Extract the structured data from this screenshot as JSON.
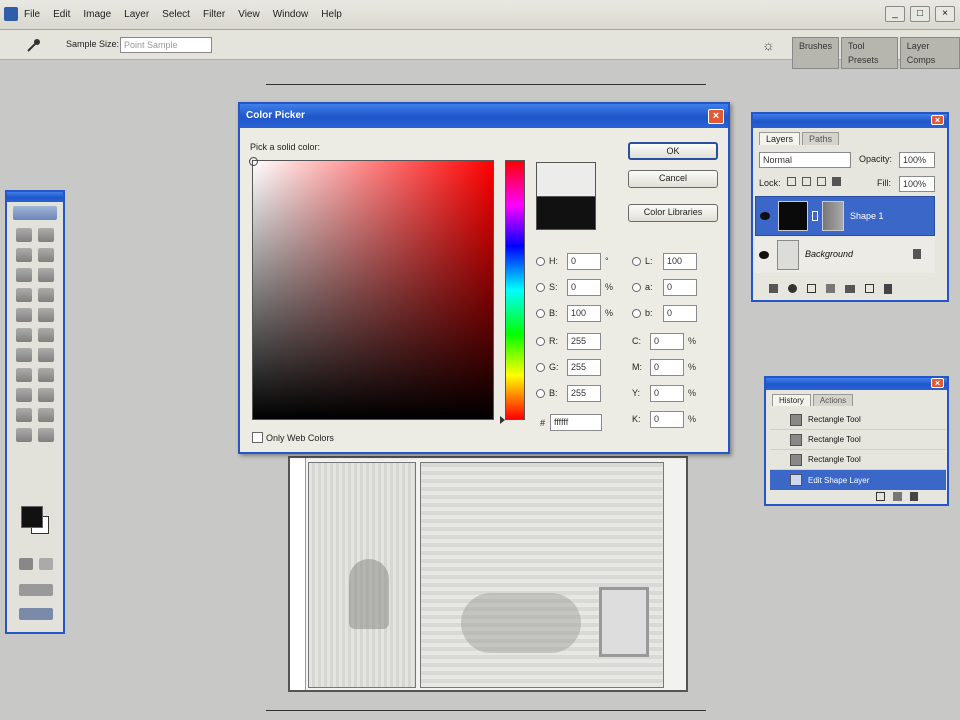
{
  "menubar": {
    "items": [
      "File",
      "Edit",
      "Image",
      "Layer",
      "Select",
      "Filter",
      "View",
      "Window",
      "Help"
    ]
  },
  "options_bar": {
    "sample_size_label": "Sample Size:",
    "sample_size_value": "Point Sample",
    "panel_tabs": [
      "Brushes",
      "Tool Presets",
      "Layer Comps"
    ]
  },
  "color_picker": {
    "title": "Color Picker",
    "prompt": "Pick a solid color:",
    "ok_label": "OK",
    "cancel_label": "Cancel",
    "libraries_label": "Color Libraries",
    "only_web_colors_label": "Only Web Colors",
    "hsb": [
      {
        "label": "H:",
        "value": "0",
        "unit": "°"
      },
      {
        "label": "S:",
        "value": "0",
        "unit": "%"
      },
      {
        "label": "B:",
        "value": "100",
        "unit": "%"
      }
    ],
    "rgb": [
      {
        "label": "R:",
        "value": "255"
      },
      {
        "label": "G:",
        "value": "255"
      },
      {
        "label": "B:",
        "value": "255"
      }
    ],
    "lab": [
      {
        "label": "L:",
        "value": "100"
      },
      {
        "label": "a:",
        "value": "0"
      },
      {
        "label": "b:",
        "value": "0"
      }
    ],
    "cmyk": [
      {
        "label": "C:",
        "value": "0",
        "unit": "%"
      },
      {
        "label": "M:",
        "value": "0",
        "unit": "%"
      },
      {
        "label": "Y:",
        "value": "0",
        "unit": "%"
      },
      {
        "label": "K:",
        "value": "0",
        "unit": "%"
      }
    ],
    "hex_label": "#",
    "hex_value": "ffffff",
    "new_color": "#ececea",
    "current_color": "#111111"
  },
  "layers_panel": {
    "tabs": [
      "Layers",
      "Paths"
    ],
    "blend_mode": "Normal",
    "opacity_label": "Opacity:",
    "opacity_value": "100%",
    "lock_label": "Lock:",
    "fill_label": "Fill:",
    "fill_value": "100%",
    "layers": [
      {
        "name": "Shape 1"
      },
      {
        "name": "Background"
      }
    ]
  },
  "history_panel": {
    "tabs": [
      "History",
      "Actions"
    ],
    "items": [
      "Rectangle Tool",
      "Rectangle Tool",
      "Rectangle Tool",
      "Edit Shape Layer"
    ]
  },
  "toolbox": {
    "foreground_color": "#111111",
    "background_color": "#ffffff"
  }
}
